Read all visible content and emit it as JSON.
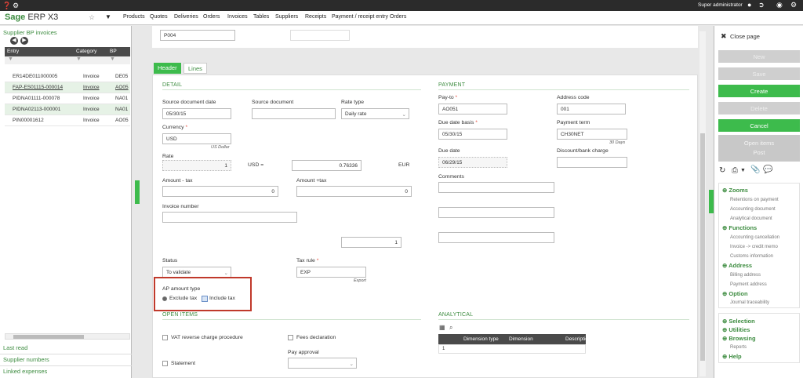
{
  "app": {
    "brand": "Sage",
    "product": "ERP X3",
    "user": "Super administrator"
  },
  "menu": [
    "Products",
    "Quotes",
    "Deliveries",
    "Orders",
    "Invoices",
    "Tables",
    "Suppliers",
    "Receipts",
    "Payment / receipt entry",
    "Orders"
  ],
  "left_panel": {
    "title": "Supplier BP invoices",
    "columns": [
      "Entry",
      "Category",
      "BP"
    ],
    "rows": [
      {
        "entry": "ER14DE011000005",
        "category": "Invoice",
        "bp": "DE05"
      },
      {
        "entry": "FAP-ES01115-000014",
        "category": "Invoice",
        "bp": "AO05",
        "selected": true
      },
      {
        "entry": "PIDNA01111-000078",
        "category": "Invoice",
        "bp": "NA01"
      },
      {
        "entry": "PIDNA02113-000001",
        "category": "Invoice",
        "bp": "NA01"
      },
      {
        "entry": "PIN00001612",
        "category": "Invoice",
        "bp": "AO05"
      }
    ],
    "links": [
      "Last read",
      "Supplier numbers",
      "Linked expenses"
    ]
  },
  "top_fields": {
    "code": "P004"
  },
  "tabs": [
    "Header",
    "Lines"
  ],
  "detail": {
    "section": "DETAIL",
    "source_doc_date_label": "Source document date",
    "source_doc_date": "05/30/15",
    "source_doc_label": "Source document",
    "source_doc": "",
    "rate_type_label": "Rate type",
    "rate_type": "Daily rate",
    "currency_label": "Currency",
    "currency": "USD",
    "currency_sub": "US Dollar",
    "rate_label": "Rate",
    "rate": "1",
    "rate_from": "USD =",
    "rate_value": "0.76336",
    "rate_to": "EUR",
    "amount_tax_label": "Amount - tax",
    "amount_tax": "0",
    "amount_plus_tax_label": "Amount +tax",
    "amount_plus_tax": "0",
    "invoice_number_label": "Invoice number",
    "invoice_number": "",
    "count": "1",
    "status_label": "Status",
    "status": "To validate",
    "tax_rule_label": "Tax rule",
    "tax_rule": "EXP",
    "tax_rule_sub": "Export",
    "ap_type_label": "AP amount type",
    "ap_opt1": "Exclude tax",
    "ap_opt2": "Include tax"
  },
  "payment": {
    "section": "PAYMENT",
    "payto_label": "Pay-to",
    "payto": "AO051",
    "address_code_label": "Address code",
    "address_code": "001",
    "due_basis_label": "Due date basis",
    "due_basis": "05/30/15",
    "pay_term_label": "Payment term",
    "pay_term": "CH30NET",
    "pay_term_sub": "30 Days",
    "due_date_label": "Due date",
    "due_date": "06/29/15",
    "discount_label": "Discount/bank charge",
    "comments_label": "Comments"
  },
  "open_items": {
    "section": "OPEN ITEMS",
    "vat_label": "VAT reverse charge procedure",
    "fees_label": "Fees declaration",
    "statement_label": "Statement",
    "pay_approval_label": "Pay approval"
  },
  "analytical": {
    "section": "ANALYTICAL",
    "columns": [
      "Dimension type",
      "Dimension",
      "Description"
    ],
    "row_index": "1"
  },
  "right_panel": {
    "close": "Close page",
    "buttons": [
      "New",
      "Save",
      "Create",
      "Delete",
      "Cancel"
    ],
    "open_items": "Open items",
    "post": "Post",
    "zooms": "Zooms",
    "zoom_items": [
      "Retentions on payment",
      "Accounting document",
      "Analytical document"
    ],
    "functions": "Functions",
    "function_items": [
      "Accounting cancellation",
      "Invoice -> credit memo",
      "Customs information"
    ],
    "address": "Address",
    "address_items": [
      "Billing address",
      "Payment address"
    ],
    "option": "Option",
    "option_items": [
      "Journal traceability"
    ],
    "bottom": [
      "Selection",
      "Utilities",
      "Browsing"
    ],
    "reports": "Reports",
    "help": "Help"
  },
  "colors": {
    "accent": "#3dbb4c",
    "brand": "#3d8c40",
    "highlight": "#c0392b",
    "dark": "#2b2b2b"
  }
}
